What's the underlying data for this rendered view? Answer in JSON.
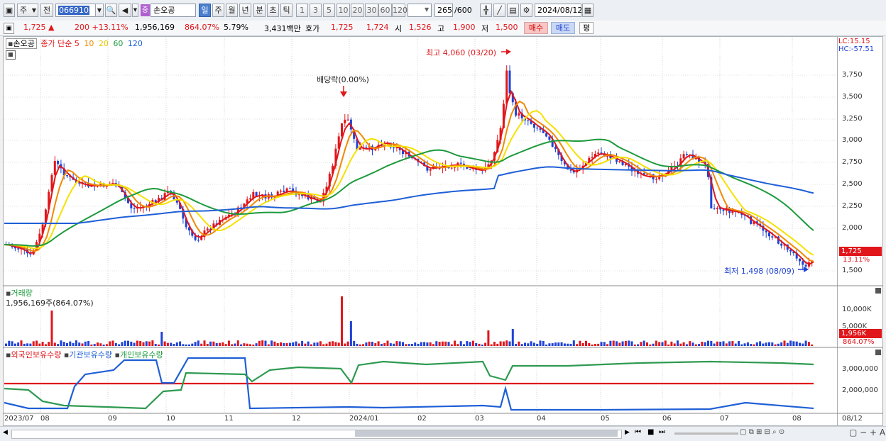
{
  "toolbar": {
    "period_label": "주",
    "jeon_label": "전",
    "code_value": "066910",
    "stock_badge": "중",
    "stock_name": "손오공",
    "periods": [
      "일",
      "주",
      "월",
      "년",
      "분",
      "초",
      "틱"
    ],
    "active_period": "일",
    "nums": [
      "1",
      "3",
      "5",
      "10",
      "20",
      "30",
      "60",
      "120"
    ],
    "count_value": "265",
    "count_total": "/600",
    "date_value": "2024/08/12"
  },
  "quote": {
    "price": "1,725",
    "change": "200",
    "change_pct": "+13.11%",
    "volume": "1,956,169",
    "vol_ratio": "864.07%",
    "turnover": "5.79%",
    "amount": "3,431백만",
    "hoga_label": "호가",
    "ask": "1,725",
    "bid": "1,724",
    "open_label": "시",
    "open": "1,526",
    "high_label": "고",
    "high": "1,900",
    "low_label": "저",
    "low": "1,500",
    "buy_label": "매수",
    "sell_label": "매도",
    "eval_label": "평"
  },
  "chart": {
    "title_tab": "손오공",
    "ma_label": "종가 단순",
    "ma_periods": [
      "5",
      "10",
      "20",
      "60",
      "120"
    ],
    "ma_colors": [
      "#e0161b",
      "#f08a00",
      "#f5e100",
      "#1c9a3c",
      "#1f5fd6"
    ],
    "lc": "LC:15.15",
    "hc": "HC:-57.51",
    "price_ticks": [
      "3,750",
      "3,500",
      "3,250",
      "3,000",
      "2,750",
      "2,500",
      "2,250",
      "2,000",
      "1,500"
    ],
    "last_price_tag": "1,725",
    "last_pct_tag": "13.11%",
    "high_annot": "최고 4,060 (03/20)",
    "low_annot": "최저 1,498 (08/09)",
    "div_annot": "배당락(0.00%)",
    "volume_title": "거래량",
    "volume_value": "1,956,169주(864.07%)",
    "vol_ticks": [
      "10,000K",
      "5,000K"
    ],
    "vol_tag": "1,956K",
    "vol_pct_tag": "864.07%",
    "holdings": [
      "외국인보유수량",
      "기관보유수량",
      "개인보유수량"
    ],
    "hold_ticks": [
      "3,000,000",
      "2,000,000"
    ],
    "x_labels": [
      "2023/07",
      "08",
      "09",
      "10",
      "11",
      "12",
      "2024/01",
      "02",
      "03",
      "04",
      "05",
      "06",
      "07",
      "08"
    ],
    "x_end": "08/12"
  }
}
